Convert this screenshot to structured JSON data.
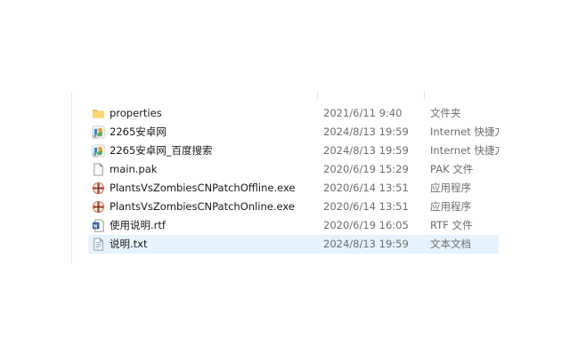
{
  "files": [
    {
      "name": "properties",
      "date": "2021/6/11 9:40",
      "type": "文件夹",
      "icon": "folder-icon"
    },
    {
      "name": "2265安卓网",
      "date": "2024/8/13 19:59",
      "type": "Internet 快捷方式",
      "icon": "internet-shortcut-icon"
    },
    {
      "name": "2265安卓网_百度搜索",
      "date": "2024/8/13 19:59",
      "type": "Internet 快捷方式",
      "icon": "internet-shortcut-icon"
    },
    {
      "name": "main.pak",
      "date": "2020/6/19 15:29",
      "type": "PAK 文件",
      "icon": "blank-file-icon"
    },
    {
      "name": "PlantsVsZombiesCNPatchOffline.exe",
      "date": "2020/6/14 13:51",
      "type": "应用程序",
      "icon": "flower-app-icon"
    },
    {
      "name": "PlantsVsZombiesCNPatchOnline.exe",
      "date": "2020/6/14 13:51",
      "type": "应用程序",
      "icon": "flower-app-icon"
    },
    {
      "name": "使用说明.rtf",
      "date": "2020/6/19 16:05",
      "type": "RTF 文件",
      "icon": "word-document-icon"
    },
    {
      "name": "说明.txt",
      "date": "2024/8/13 19:59",
      "type": "文本文档",
      "icon": "text-document-icon"
    }
  ],
  "selected_index": 7,
  "colors": {
    "folder": "#f8d775",
    "selection": "#e5f3ff",
    "secondary_text": "#6d6d6d"
  }
}
